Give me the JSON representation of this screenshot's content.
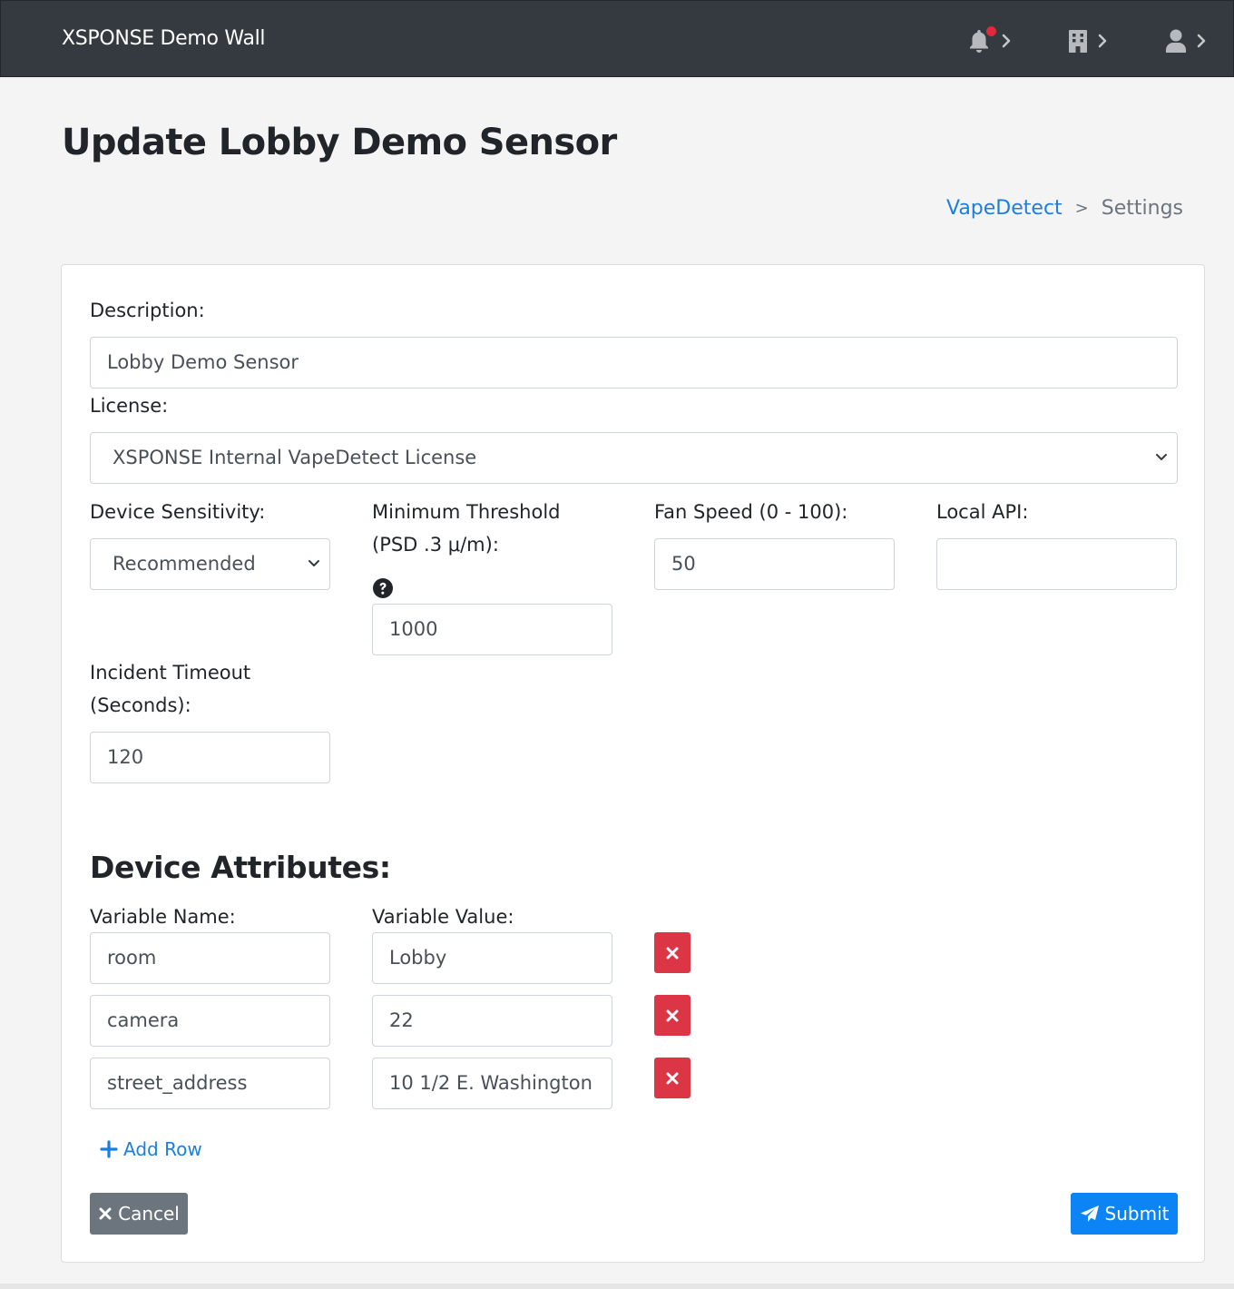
{
  "navbar": {
    "brand": "XSPONSE Demo Wall",
    "icons": [
      "bell-icon",
      "building-icon",
      "user-icon"
    ],
    "notification_dot_color": "#e4273a"
  },
  "page": {
    "title": "Update Lobby Demo Sensor",
    "breadcrumb": {
      "link": "VapeDetect",
      "separator": ">",
      "current": "Settings"
    }
  },
  "form": {
    "description": {
      "label": "Description:",
      "value": "Lobby Demo Sensor"
    },
    "license": {
      "label": "License:",
      "value": "XSPONSE Internal VapeDetect License"
    },
    "sensitivity": {
      "label": "Device Sensitivity:",
      "value": "Recommended"
    },
    "threshold": {
      "label_line1": "Minimum Threshold",
      "label_line2": "(PSD .3 μ/m):",
      "value": "1000"
    },
    "fan_speed": {
      "label": "Fan Speed (0 - 100):",
      "value": "50"
    },
    "local_api": {
      "label": "Local API:",
      "value": ""
    },
    "incident_timeout": {
      "label_line1": "Incident Timeout",
      "label_line2": "(Seconds):",
      "value": "120"
    }
  },
  "attributes": {
    "title": "Device Attributes:",
    "name_header": "Variable Name:",
    "value_header": "Variable Value:",
    "rows": [
      {
        "name": "room",
        "value": "Lobby"
      },
      {
        "name": "camera",
        "value": "22"
      },
      {
        "name": "street_address",
        "value": "10 1/2 E. Washington"
      }
    ],
    "add_row_label": "Add Row"
  },
  "actions": {
    "cancel_label": "Cancel",
    "submit_label": "Submit"
  },
  "colors": {
    "navbar": "#343a40",
    "link": "#1a7fe0",
    "danger": "#dc3545",
    "primary": "#0d84f5",
    "secondary": "#6c757d"
  }
}
